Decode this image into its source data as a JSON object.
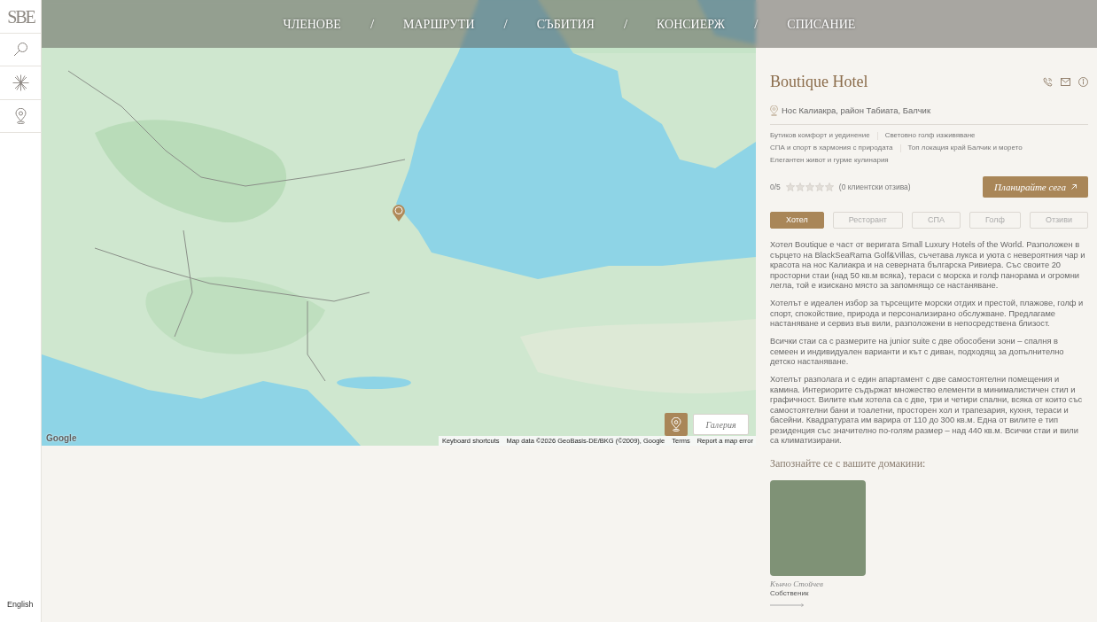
{
  "sidebar": {
    "logo": "SBE",
    "language": "English"
  },
  "nav": [
    {
      "kind": "link",
      "label": "ЧЛЕНОВЕ"
    },
    {
      "kind": "separator",
      "label": "/"
    },
    {
      "kind": "link",
      "label": "МАРШРУТИ"
    },
    {
      "kind": "separator",
      "label": "/"
    },
    {
      "kind": "link",
      "label": "СЪБИТИЯ"
    },
    {
      "kind": "separator",
      "label": "/"
    },
    {
      "kind": "link",
      "label": "КОНСИЕРЖ"
    },
    {
      "kind": "separator",
      "label": "/"
    },
    {
      "kind": "link",
      "label": "СПИСАНИЕ"
    }
  ],
  "map": {
    "logo": "Google",
    "attribution": [
      "Keyboard shortcuts",
      "Map data ©2026 GeoBasis-DE/BKG (©2009), Google",
      "Terms",
      "Report a map error"
    ],
    "gallery_button": "Галерия"
  },
  "hotel": {
    "title": "Boutique Hotel",
    "address": "Нос Калиакра, район Табиата, Балчик",
    "features": [
      "Бутиков комфорт и уединение",
      "Световно голф изживяване",
      "СПА и спорт в хармония с природата",
      "Топ локация край Балчик и морето",
      "Елегантен живот и гурме кулинария"
    ],
    "rating": {
      "score": "0/5",
      "stars": 0,
      "reviews": "(0 клиентски отзива)"
    },
    "cta": "Планирайте сега"
  },
  "tabs": [
    {
      "label": "Хотел",
      "selected": true
    },
    {
      "label": "Ресторант",
      "selected": false
    },
    {
      "label": "СПА",
      "selected": false
    },
    {
      "label": "Голф",
      "selected": false
    },
    {
      "label": "Отзиви",
      "selected": false
    }
  ],
  "description": [
    "Хотел Boutique е част от веригата Small Luxury Hotels of the World. Разположен в сърцето на BlackSeaRama Golf&Villas, съчетава лукса и уюта с невероятния чар и красота на нос Калиакра и на северната българска Ривиера. Със своите 20 просторни стаи (над 50 кв.м всяка), тераси с морска и голф панорама и огромни легла, той е изискано място за запомнящо се настаняване.",
    "Хотелът е идеален избор за търсещите морски отдих и престой, плажове, голф и спорт, спокойствие, природа и персонализирано обслужване. Предлагаме настаняване и сервиз във вили, разположени в непосредствена близост.",
    "Всички стаи са с размерите на junior suite с две обособени зони – спалня в семеен и индивидуален варианти и кът с диван, подходящ за допълнително детско настаняване.",
    "Хотелът разполага и с един апартамент с две самостоятелни помещения и камина. Интериорите съдържат множество елементи в минималистичен стил и графичност. Вилите към хотела са с две, три и четири спални, всяка от които със самостоятелни бани и тоалетни, просторен хол и трапезария, кухня, тераси и басейни. Квадратурата им варира от 110 до 300 кв.м. Една от вилите е тип резиденция със значително по-голям размер – над 440 кв.м. Всички стаи и вили са климатизирани."
  ],
  "hosts": {
    "heading": "Запознайте се с вашите домакини:",
    "people": [
      {
        "name": "Кънчо Стойчев",
        "role": "Собственик"
      }
    ]
  }
}
